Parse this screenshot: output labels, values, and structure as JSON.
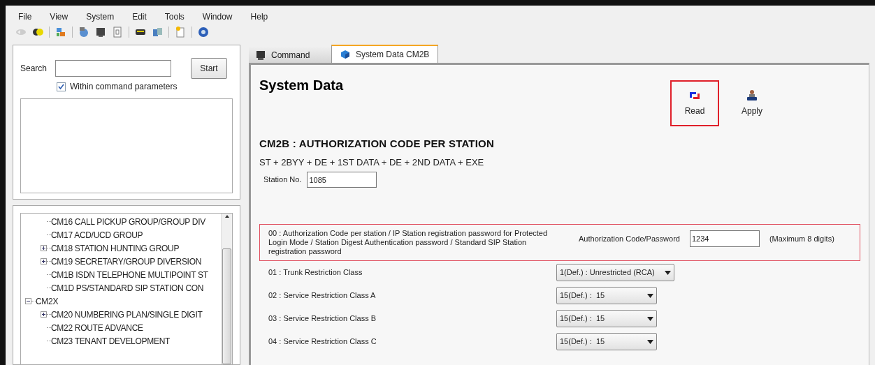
{
  "menu": [
    "File",
    "View",
    "System",
    "Edit",
    "Tools",
    "Window",
    "Help"
  ],
  "search": {
    "label": "Search",
    "button": "Start",
    "option": {
      "label": "Within command parameters",
      "checked": true
    }
  },
  "tree": [
    {
      "children": [
        {
          "label": "CM16 CALL PICKUP GROUP/GROUP DIV"
        },
        {
          "label": "CM17 ACD/UCD GROUP"
        },
        {
          "label": "CM18 STATION HUNTING GROUP",
          "expanded": false
        },
        {
          "label": "CM19 SECRETARY/GROUP DIVERSION",
          "expanded": false
        },
        {
          "label": "CM1B ISDN TELEPHONE MULTIPOINT ST"
        },
        {
          "label": "CM1D PS/STANDARD SIP STATION CON"
        }
      ]
    },
    {
      "label": "CM2X",
      "expanded": true,
      "children": [
        {
          "label": "CM20 NUMBERING PLAN/SINGLE DIGIT",
          "expanded": false
        },
        {
          "label": "CM22 ROUTE ADVANCE"
        },
        {
          "label": "CM23 TENANT DEVELOPMENT"
        }
      ]
    }
  ],
  "tabs": [
    {
      "label": "Command",
      "selected": false
    },
    {
      "label": "System Data CM2B",
      "selected": true
    }
  ],
  "page": {
    "title": "System Data",
    "actions": [
      {
        "label": "Read",
        "kind": "read",
        "highlighted": true
      },
      {
        "label": "Apply",
        "kind": "apply",
        "highlighted": false
      }
    ],
    "command_title": "CM2B : AUTHORIZATION CODE PER STATION",
    "sequence": "ST + 2BYY + DE + 1ST DATA + DE + 2ND DATA + EXE",
    "station": {
      "label": "Station No.",
      "value": "1085"
    },
    "fields": [
      {
        "kind": "text",
        "highlighted": true,
        "label": "00 : Authorization Code per station / IP Station registration password for Protected Login Mode / Station Digest Authentication password / Standard SIP Station registration password",
        "field_label": "Authorization Code/Password",
        "value": "1234",
        "hint": "(Maximum 8 digits)"
      },
      {
        "kind": "select",
        "highlighted": false,
        "label": "01 : Trunk Restriction Class",
        "value": "1(Def.) : Unrestricted (RCA)"
      },
      {
        "kind": "select",
        "highlighted": false,
        "label": "02 : Service Restriction Class A",
        "value": "15(Def.) :  15"
      },
      {
        "kind": "select",
        "highlighted": false,
        "label": "03 : Service Restriction Class B",
        "value": "15(Def.) :  15"
      },
      {
        "kind": "select",
        "highlighted": false,
        "label": "04 : Service Restriction Class C",
        "value": "15(Def.) :  15"
      }
    ]
  }
}
